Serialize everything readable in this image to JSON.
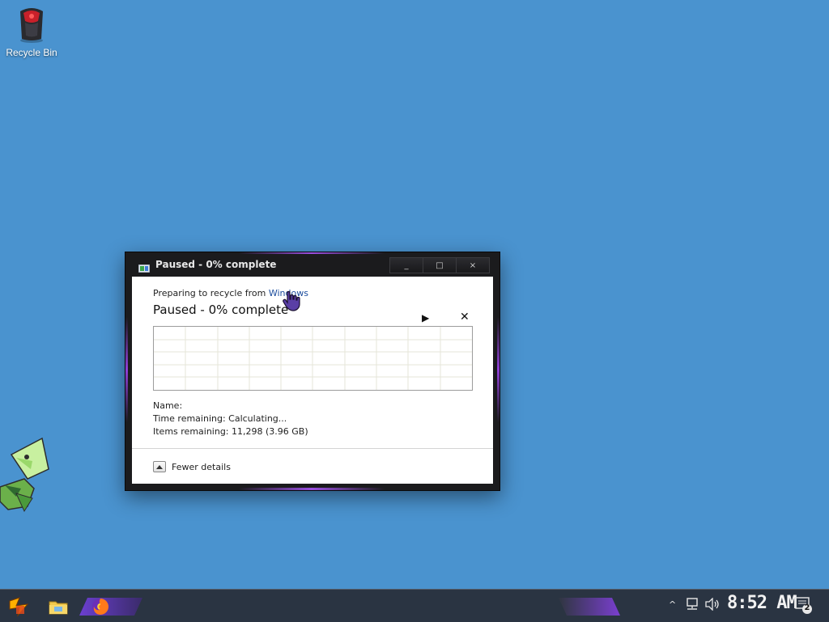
{
  "desktop": {
    "icons": [
      {
        "label": "Recycle Bin",
        "icon": "recycle-bin-icon"
      }
    ]
  },
  "dialog": {
    "title": "Paused - 0% complete",
    "window_controls": {
      "minimize": "_",
      "maximize": "□",
      "close": "×"
    },
    "preparing_text": "Preparing to recycle from",
    "source_link": "Windows",
    "status_text": "Paused - 0% complete",
    "progress_percent": 0,
    "resume_icon": "▶",
    "cancel_icon": "✕",
    "name_label": "Name:",
    "time_remaining": "Time remaining: Calculating...",
    "items_remaining": "Items remaining: 11,298 (3.96 GB)",
    "fewer_details": "Fewer details"
  },
  "taskbar": {
    "pinned": [
      {
        "name": "start",
        "icon": "start-icon"
      },
      {
        "name": "file-explorer",
        "icon": "folder-icon"
      },
      {
        "name": "firefox",
        "icon": "firefox-icon"
      }
    ],
    "tray": {
      "chevron": "^",
      "network_icon": "network-icon",
      "volume_icon": "volume-icon",
      "clock": "8:52 AM",
      "notification_count": "2"
    }
  },
  "colors": {
    "desktop": "#4a93cf",
    "taskbar": "#2a3442",
    "accent": "#8e3fd6",
    "link": "#1a4b9c"
  }
}
